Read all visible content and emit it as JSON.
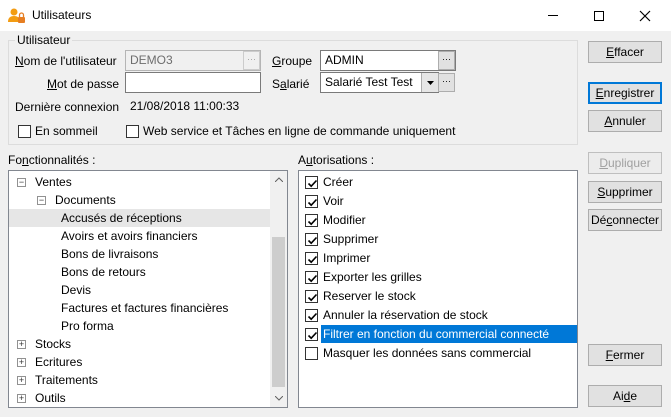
{
  "window": {
    "title": "Utilisateurs"
  },
  "user_group": {
    "legend": "Utilisateur",
    "username_label_pre": "",
    "username_label_u": "N",
    "username_label_post": "om de l'utilisateur",
    "username_value": "DEMO3",
    "password_label_u": "M",
    "password_label_post": "ot de passe",
    "password_value": "",
    "last_login_label": "Dernière connexion",
    "last_login_value": "21/08/2018 11:00:33",
    "group_label_u": "G",
    "group_label_post": "roupe",
    "group_value": "ADMIN",
    "employee_label_pre": "S",
    "employee_label_u": "a",
    "employee_label_post": "larié",
    "employee_value": "Salarié Test Test",
    "sleep_label": "En sommeil",
    "sleep_checked": false,
    "webservice_label": "Web service et Tâches en ligne de commande uniquement",
    "webservice_checked": false
  },
  "features": {
    "label_pre": "Fo",
    "label_u": "n",
    "label_post": "ctionnalités :",
    "tree": [
      {
        "label": "Ventes",
        "level": 0,
        "expander": "minus"
      },
      {
        "label": "Documents",
        "level": 1,
        "expander": "minus"
      },
      {
        "label": "Accusés de réceptions",
        "level": 2,
        "expander": "none",
        "selected": true
      },
      {
        "label": "Avoirs et avoirs financiers",
        "level": 2,
        "expander": "none"
      },
      {
        "label": "Bons de livraisons",
        "level": 2,
        "expander": "none"
      },
      {
        "label": "Bons de retours",
        "level": 2,
        "expander": "none"
      },
      {
        "label": "Devis",
        "level": 2,
        "expander": "none"
      },
      {
        "label": "Factures et factures financières",
        "level": 2,
        "expander": "none"
      },
      {
        "label": "Pro forma",
        "level": 2,
        "expander": "none"
      },
      {
        "label": "Stocks",
        "level": 0,
        "expander": "plus"
      },
      {
        "label": "Ecritures",
        "level": 0,
        "expander": "plus"
      },
      {
        "label": "Traitements",
        "level": 0,
        "expander": "plus"
      },
      {
        "label": "Outils",
        "level": 0,
        "expander": "plus"
      }
    ]
  },
  "permissions": {
    "label_pre": "A",
    "label_u": "u",
    "label_post": "torisations :",
    "items": [
      {
        "label": "Créer",
        "checked": true
      },
      {
        "label": "Voir",
        "checked": true
      },
      {
        "label": "Modifier",
        "checked": true
      },
      {
        "label": "Supprimer",
        "checked": true
      },
      {
        "label": "Imprimer",
        "checked": true
      },
      {
        "label": "Exporter les grilles",
        "checked": true
      },
      {
        "label": "Reserver le stock",
        "checked": true
      },
      {
        "label": "Annuler la réservation de stock",
        "checked": true
      },
      {
        "label": "Filtrer en fonction du commercial connecté",
        "checked": true,
        "highlighted": true
      },
      {
        "label": "Masquer les données sans commercial",
        "checked": false
      }
    ]
  },
  "buttons": {
    "clear_u": "E",
    "clear_post": "ffacer",
    "save_u": "E",
    "save_pre": "",
    "save_post": "nregistrer",
    "cancel_u": "A",
    "cancel_post": "nnuler",
    "duplicate_u": "D",
    "duplicate_post": "upliquer",
    "delete_u": "S",
    "delete_post": "upprimer",
    "disconnect_pre": "Dé",
    "disconnect_u": "c",
    "disconnect_post": "onnecter",
    "close_u": "F",
    "close_post": "ermer",
    "help_pre": "Ai",
    "help_u": "d",
    "help_post": "e"
  },
  "colors": {
    "selection": "#0078d7",
    "tree_selected": "#e6e6e6"
  }
}
